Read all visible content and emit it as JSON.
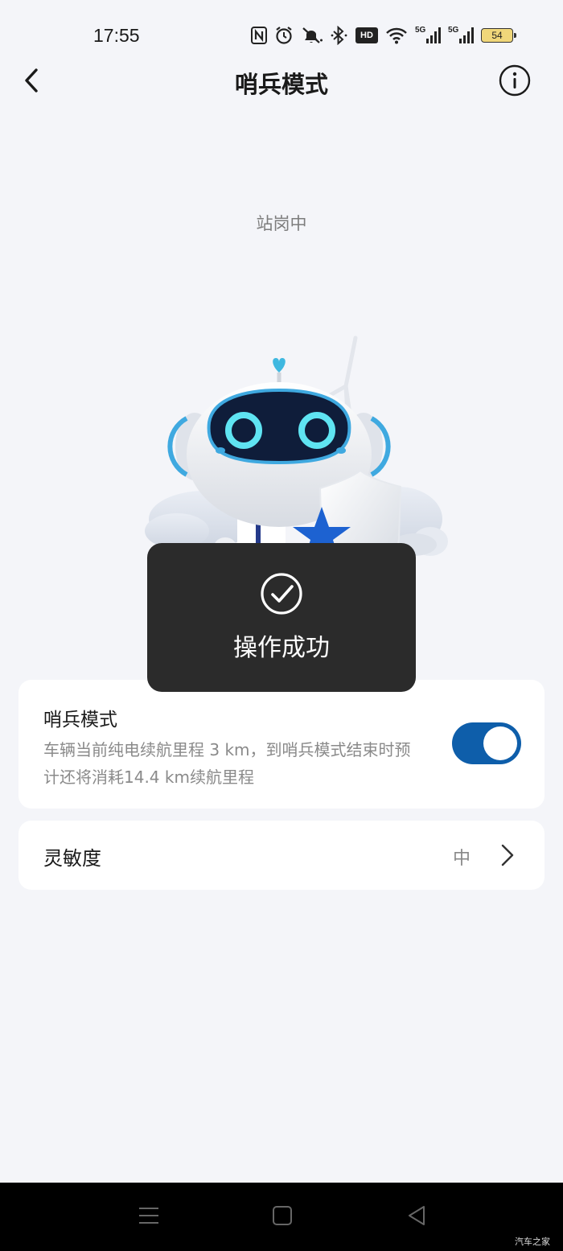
{
  "status_bar": {
    "time": "17:55",
    "network_1": "5G",
    "network_2": "5G",
    "hd_label": "HD",
    "battery": "54"
  },
  "header": {
    "title": "哨兵模式"
  },
  "status_label": "站岗中",
  "toast": {
    "message": "操作成功"
  },
  "sentry_card": {
    "title": "哨兵模式",
    "description": "车辆当前纯电续航里程 3 km，到哨兵模式结束时预计还将消耗14.4 km续航里程",
    "toggle_on": true
  },
  "sensitivity_card": {
    "label": "灵敏度",
    "value": "中"
  },
  "watermark": "汽车之家",
  "colors": {
    "background": "#f4f5f9",
    "accent": "#0e5eaa",
    "toast_bg": "#2b2b2b"
  }
}
